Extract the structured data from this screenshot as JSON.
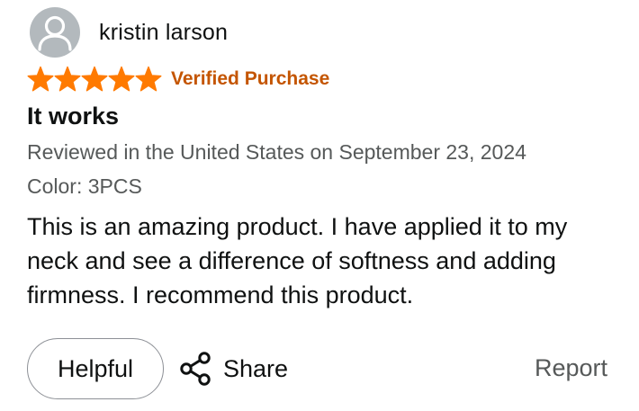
{
  "review": {
    "author": "kristin larson",
    "rating": 5,
    "rating_max": 5,
    "star_color": "#ff7a00",
    "verified_label": "Verified Purchase",
    "verified_color": "#c45500",
    "title": "It works",
    "date_line": "Reviewed in the United States on September 23, 2024",
    "variant_line": "Color: 3PCS",
    "body": "This is an amazing product. I have applied it to my neck and see a difference of softness and adding firmness. I recommend this product."
  },
  "actions": {
    "helpful_label": "Helpful",
    "share_label": "Share",
    "report_label": "Report"
  },
  "icons": {
    "avatar": "person-icon",
    "star": "star-icon",
    "share": "share-icon"
  }
}
